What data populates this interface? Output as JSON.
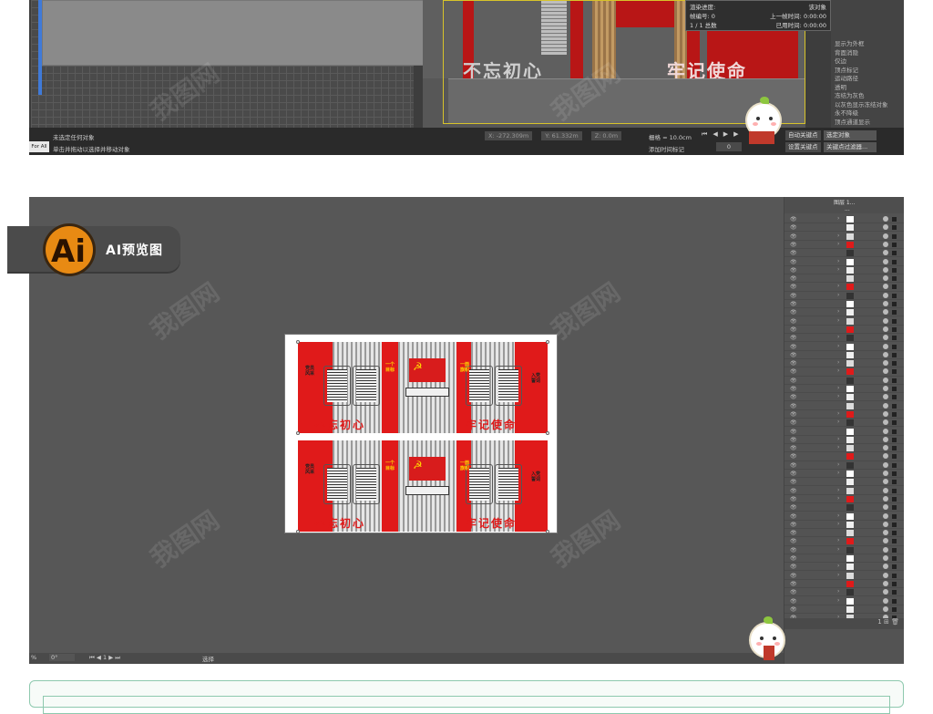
{
  "max": {
    "render_dialog": {
      "title": "渲染进度:",
      "frame_label": "帧编号:",
      "frame_value": "0",
      "last_frame_label": "上一帧时间:",
      "last_frame_value": "0:00:00",
      "progress": "1 / 1",
      "total_label": "总数",
      "elapsed_label": "已用时间:",
      "elapsed_value": "0:00:00",
      "right_label": "该对象"
    },
    "right_menu": [
      "显示为外框",
      "背面消隐",
      "仅边",
      "顶点标记",
      "运动路径",
      "透明",
      "冻结为灰色",
      "以灰色显示冻结对象",
      "永不降级",
      "顶点通道显示"
    ],
    "scene": {
      "slogan_left": "不忘初心",
      "slogan_right": "牢记使命"
    },
    "status": {
      "chip": "For All",
      "line1": "未选定任何对象",
      "line2": "单击并拖动以选择并移动对象",
      "x_value": "X: -272.309m",
      "y_value": "Y: 61.332m",
      "z_value": "Z: 0.0m",
      "grid": "栅格 = 10.0cm",
      "time_tag": "添加时间标记",
      "frame": "0",
      "autokey": "自动关键点",
      "setkey": "设置关键点",
      "selected_dropdown": "选定对象",
      "key_filter": "关键点过滤器..."
    }
  },
  "ai": {
    "badge_logo": "Ai",
    "badge_label": "AI预览图",
    "artboard": {
      "top": {
        "slogan_left": "不忘初心",
        "slogan_right": "牢记使命",
        "side_left": "党员风采",
        "side_right": "入党誓词",
        "mid_left_tag": "一个目标",
        "mid_right_tag": "一面旗帜"
      },
      "bottom": {
        "slogan_left": "不忘初心",
        "slogan_right": "牢记使命",
        "side_left": "党员风采",
        "side_right": "入党誓词",
        "mid_left_tag": "一个目标",
        "mid_right_tag": "一面旗帜"
      }
    },
    "layers": {
      "top_label": "图层 1...",
      "sub_label": "...",
      "footer_count": "1",
      "rows": 48
    },
    "status": {
      "zoom": "%",
      "angle": "0°",
      "page": "1",
      "tool": "选择"
    }
  },
  "watermark": "我图网",
  "colors": {
    "party_red": "#e01a1a",
    "gold": "#ffd700",
    "ai_orange": "#e88a13"
  }
}
